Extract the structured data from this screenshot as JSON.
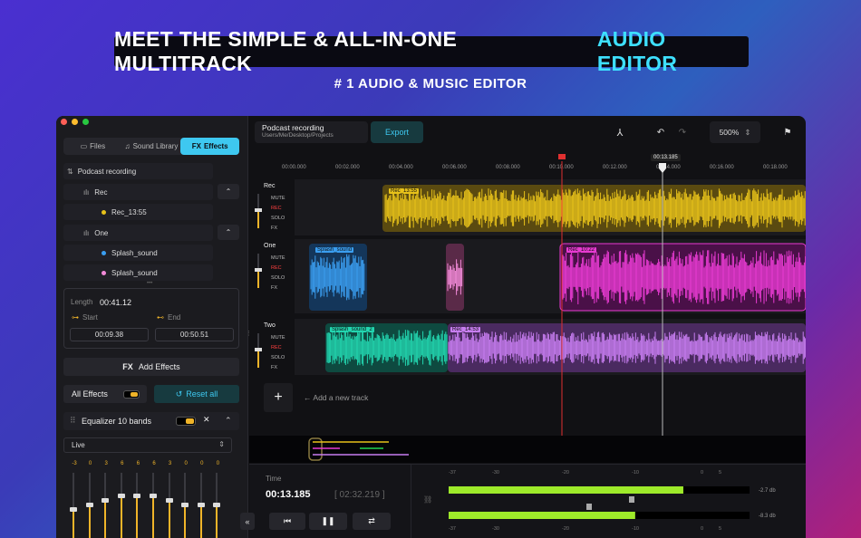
{
  "hero": {
    "title_main": "MEET THE SIMPLE & ALL-IN-ONE MULTITRACK",
    "title_accent": "AUDIO EDITOR",
    "subtitle": "# 1 AUDIO & MUSIC EDITOR"
  },
  "colors": {
    "accent": "#3ec8f0",
    "orange": "#f0b429",
    "yellow": "#e8c21a",
    "blue": "#3a9ef0",
    "pink": "#e83ad2",
    "teal": "#22d6b0",
    "violet": "#c77df0",
    "green": "#9eea2a",
    "playhead": "#e03030"
  },
  "sidebar": {
    "tabs": [
      {
        "label": "Files",
        "icon": "folder-icon"
      },
      {
        "label": "Sound Library",
        "icon": "music-icon"
      },
      {
        "label": "Effects",
        "icon": "fx-icon",
        "prefix": "FX"
      }
    ],
    "project": "Podcast recording",
    "tree": {
      "rec_track": "Rec",
      "rec_file": "Rec_13:55",
      "one_track": "One",
      "splash1": "Splash_sound",
      "splash2": "Splash_sound"
    },
    "length_label": "Length",
    "length_value": "00:41.12",
    "start_label": "Start",
    "end_label": "End",
    "start_value": "00:09.38",
    "end_value": "00:50.51",
    "add_effects": "Add Effects",
    "fx": "FX",
    "all_effects": "All Effects",
    "reset_all": "Reset all",
    "eq_name": "Equalizer 10 bands",
    "eq_preset": "Live",
    "eq_values": [
      "-3",
      "0",
      "3",
      "6",
      "6",
      "6",
      "3",
      "0",
      "0",
      "0"
    ]
  },
  "toolbar": {
    "project": "Podcast recording",
    "path": "Users/Me/Desktop/Projects",
    "export": "Export",
    "zoom": "500%"
  },
  "ruler": {
    "ticks": [
      "00:00.000",
      "00:02.000",
      "00:04.000",
      "00:06.000",
      "00:08.000",
      "00:10.000",
      "00:12.000",
      "00:14.000",
      "00:16.000",
      "00:18.000"
    ],
    "playhead_time": "00:13.185"
  },
  "tracks": [
    {
      "name": "Rec",
      "controls": [
        "MUTE",
        "REC",
        "SOLO",
        "FX"
      ]
    },
    {
      "name": "One",
      "controls": [
        "MUTE",
        "REC",
        "SOLO",
        "FX"
      ]
    },
    {
      "name": "Two",
      "controls": [
        "MUTE",
        "REC",
        "SOLO",
        "FX"
      ]
    }
  ],
  "clips": {
    "rec": "Rec_13:55",
    "splash": "Splash_sound",
    "one_rec": "Rec_10:22",
    "two_splash": "Splash_sound_2",
    "two_rec": "Rec_14:53"
  },
  "add_track": "Add a new track",
  "transport": {
    "time_label": "Time",
    "time": "00:13.185",
    "total": "[ 02:32.219 ]"
  },
  "meters": {
    "scale": [
      "-37",
      "-30",
      "-20",
      "-10",
      "0",
      "5"
    ],
    "left_db": "-2.7 db",
    "right_db": "-8.3 db",
    "left_level": 0.78,
    "right_level": 0.62
  }
}
